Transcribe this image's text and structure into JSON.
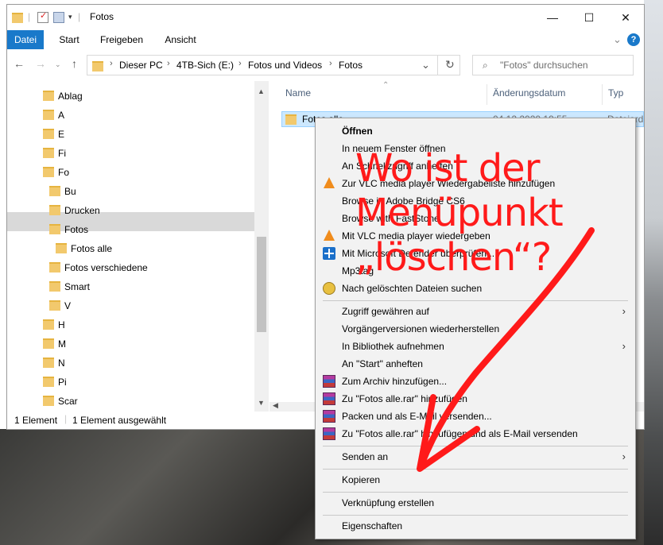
{
  "window": {
    "title": "Fotos",
    "controls": {
      "minimize": "—",
      "maximize": "☐",
      "close": "✕"
    }
  },
  "ribbon": {
    "tabs": [
      "Datei",
      "Start",
      "Freigeben",
      "Ansicht"
    ],
    "expand": "⌄",
    "help": "?"
  },
  "address": {
    "back": "←",
    "forward": "→",
    "up": "↑",
    "crumbs": [
      "Dieser PC",
      "4TB-Sich (E:)",
      "Fotos und Videos",
      "Fotos"
    ],
    "sep": "›",
    "dropdown": "⌄",
    "refresh": "↻",
    "search_placeholder": "\"Fotos\" durchsuchen"
  },
  "nav_tree": [
    {
      "label": "Ablag"
    },
    {
      "label": "A"
    },
    {
      "label": "E"
    },
    {
      "label": "Fi"
    },
    {
      "label": "Fo"
    },
    {
      "label": "Bu"
    },
    {
      "label": "Drucken"
    },
    {
      "label": "Fotos"
    },
    {
      "label": "Fotos alle"
    },
    {
      "label": "Fotos verschiedene"
    },
    {
      "label": "Smart"
    },
    {
      "label": "V"
    },
    {
      "label": "H"
    },
    {
      "label": "M"
    },
    {
      "label": "N"
    },
    {
      "label": "Pi"
    },
    {
      "label": "Scar"
    }
  ],
  "columns": {
    "name": "Name",
    "date": "Änderungsdatum",
    "type": "Typ"
  },
  "file": {
    "name": "Fotos alle",
    "date": "04.12.2020 19:55",
    "type": "Dateiord"
  },
  "status": {
    "count": "1 Element",
    "selected": "1 Element ausgewählt"
  },
  "context_menu": {
    "items": [
      {
        "label": "Öffnen"
      },
      {
        "label": "In neuem Fenster öffnen"
      },
      {
        "label": "An Schnellzugriff anheften"
      },
      {
        "label": "Zur VLC media player Wiedergabeliste hinzufügen"
      },
      {
        "label": "Browse in Adobe Bridge CS6"
      },
      {
        "label": "Browse with FastStone"
      },
      {
        "label": "Mit VLC media player wiedergeben"
      },
      {
        "label": "Mit Microsoft Defender überprüfen..."
      },
      {
        "label": "Mp3tag"
      },
      {
        "label": "Nach gelöschten Dateien suchen"
      },
      {
        "label": "Zugriff gewähren auf"
      },
      {
        "label": "Vorgängerversionen wiederherstellen"
      },
      {
        "label": "In Bibliothek aufnehmen"
      },
      {
        "label": "An \"Start\" anheften"
      },
      {
        "label": "Zum Archiv hinzufügen..."
      },
      {
        "label": "Zu \"Fotos alle.rar\" hinzufügen"
      },
      {
        "label": "Packen und als E-Mail versenden..."
      },
      {
        "label": "Zu \"Fotos alle.rar\" hinzufügen und als E-Mail versenden"
      },
      {
        "label": "Senden an"
      },
      {
        "label": "Kopieren"
      },
      {
        "label": "Verknüpfung erstellen"
      },
      {
        "label": "Eigenschaften"
      }
    ],
    "arrow": "›"
  },
  "annotation": {
    "lines": [
      "Wo ist der",
      "Menüpunkt",
      "„löschen“?"
    ],
    "color": "#ff1a1a"
  },
  "colors": {
    "accent": "#1979ca",
    "selection": "#cce8ff",
    "folder": "#f2c96d"
  }
}
